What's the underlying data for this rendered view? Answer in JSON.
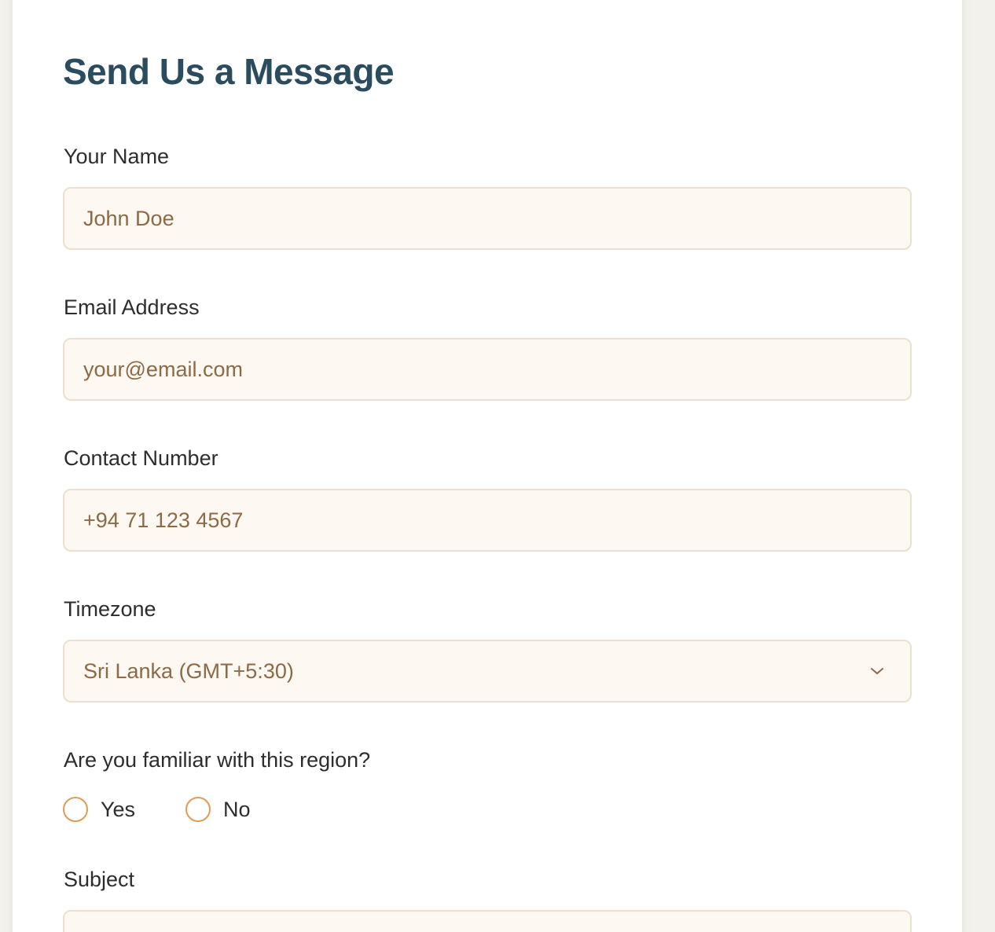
{
  "form": {
    "title": "Send Us a Message",
    "fields": {
      "name": {
        "label": "Your Name",
        "placeholder": "John Doe"
      },
      "email": {
        "label": "Email Address",
        "placeholder": "your@email.com"
      },
      "phone": {
        "label": "Contact Number",
        "placeholder": "+94 71 123 4567"
      },
      "timezone": {
        "label": "Timezone",
        "selected": "Sri Lanka (GMT+5:30)",
        "icon": "chevron-down-icon"
      },
      "familiar": {
        "label": "Are you familiar with this region?",
        "options": [
          "Yes",
          "No"
        ]
      },
      "subject": {
        "label": "Subject"
      }
    }
  },
  "colors": {
    "title": "#2b4c5e",
    "field_background": "#fdf8f1",
    "field_border": "#ece0cf",
    "placeholder": "#8b6a45",
    "radio_accent": "#e29a55"
  }
}
